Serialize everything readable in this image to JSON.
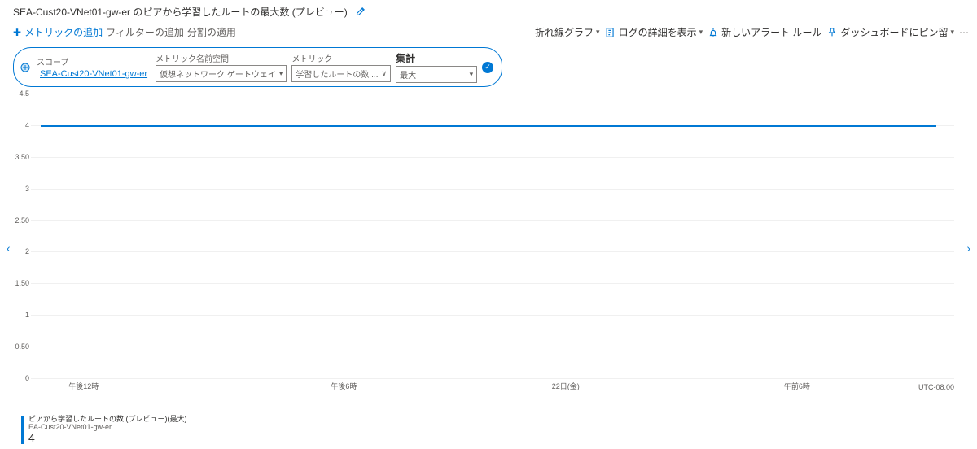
{
  "header": {
    "title": "SEA-Cust20-VNet01-gw-er のピアから学習したルートの最大数 (プレビュー)"
  },
  "toolbar": {
    "add_metric": "メトリックの追加",
    "add_filter": "フィルターの追加",
    "apply_split": "分割の適用",
    "chart_type": "折れ線グラフ",
    "drill_logs": "ログの詳細を表示",
    "new_alert": "新しいアラート ルール",
    "pin_dashboard": "ダッシュボードにピン留"
  },
  "config": {
    "scope_label": "スコープ",
    "scope_value": "SEA-Cust20-VNet01-gw-er",
    "namespace_label": "メトリック名前空間",
    "namespace_value": "仮想ネットワーク ゲートウェイ",
    "metric_label": "メトリック",
    "metric_value": "学習したルートの数 ...",
    "agg_label": "集計",
    "agg_value": "最大"
  },
  "chart_data": {
    "type": "line",
    "ylim": [
      0,
      4.5
    ],
    "yticks": [
      4.5,
      4,
      3.5,
      3,
      2.5,
      2,
      1.5,
      1,
      0.5,
      0
    ],
    "xticks": [
      "午後12時",
      "午後6時",
      "22日(金)",
      "午前6時"
    ],
    "series": [
      {
        "name": "ピアから学習したルートの数 (プレビュー)(最大)",
        "resource": "EA-Cust20-VNet01-gw-er",
        "value_constant": 4
      }
    ],
    "timezone": "UTC-08:00"
  },
  "legend": {
    "title": "ピアから学習したルートの数 (プレビュー)(最大)",
    "subtitle": "EA-Cust20-VNet01-gw-er",
    "value": "4"
  }
}
